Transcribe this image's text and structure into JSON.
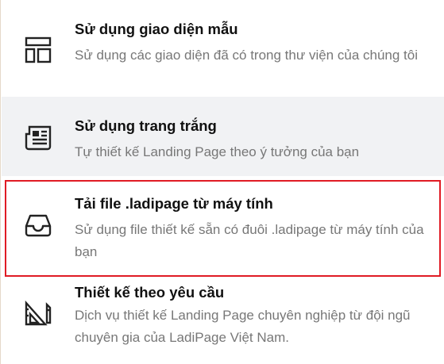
{
  "options": [
    {
      "icon": "layout-template-icon",
      "title": "Sử dụng giao diện mẫu",
      "description": "Sử dụng các giao diện đã có trong thư viện của chúng tôi"
    },
    {
      "icon": "newspaper-icon",
      "title": "Sử dụng trang trắng",
      "description": "Tự thiết kế Landing Page theo ý tưởng của bạn"
    },
    {
      "icon": "inbox-tray-icon",
      "title": "Tải file .ladipage từ máy tính",
      "description": "Sử dụng file thiết kế sẵn có đuôi .ladipage từ máy tính của bạn"
    },
    {
      "icon": "design-ruler-pencil-icon",
      "title": "Thiết kế theo yêu cầu",
      "description": "Dịch vụ thiết kế Landing Page chuyên nghiệp từ đội ngũ chuyên gia của LadiPage Việt Nam."
    }
  ],
  "colors": {
    "highlight_border": "#e01b24",
    "hover_background": "#f1f2f4",
    "title_text": "#111111",
    "description_text": "#777777"
  }
}
